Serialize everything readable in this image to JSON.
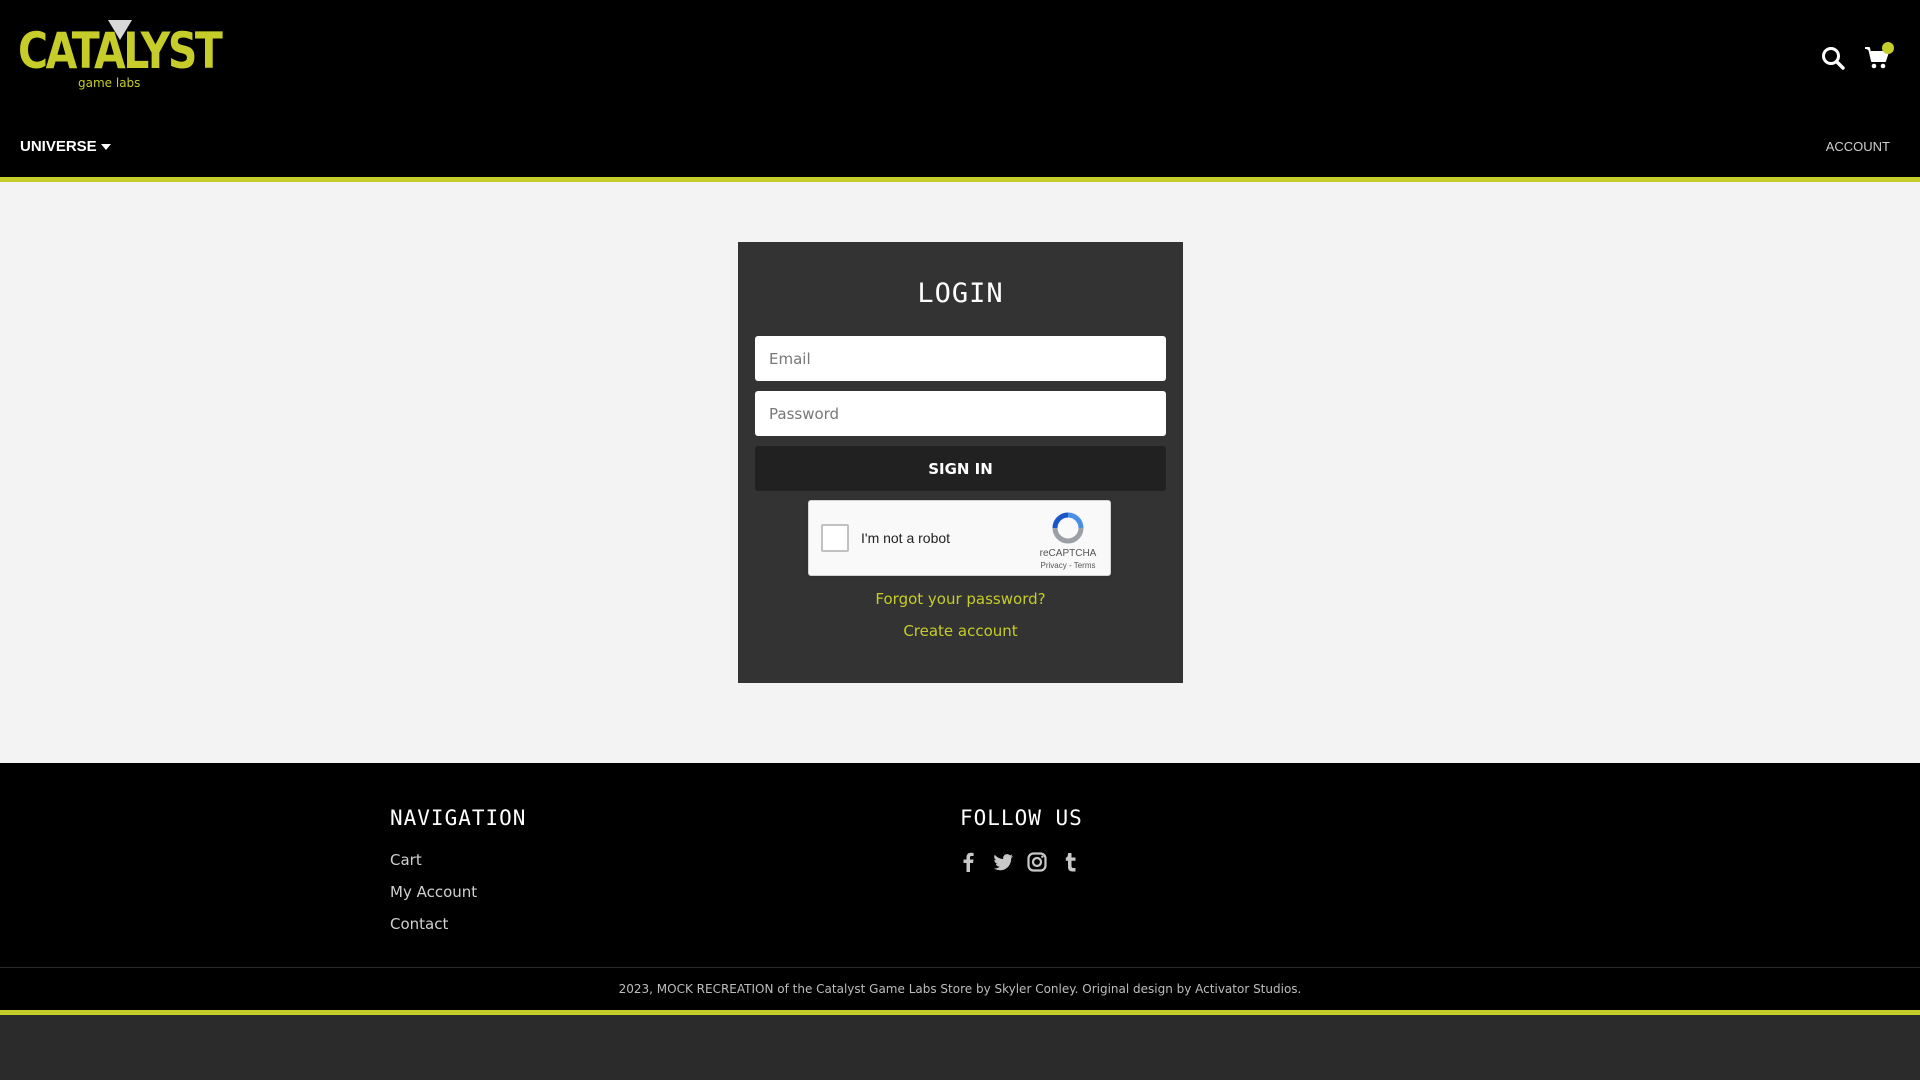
{
  "brand": {
    "logo_word": "CATALYST",
    "logo_sub": "game labs",
    "accent_color": "#c6cc29"
  },
  "header": {
    "nav_universe": "UNIVERSE",
    "nav_account": "ACCOUNT",
    "icons": [
      "search-icon",
      "cart-icon"
    ]
  },
  "login": {
    "title": "LOGIN",
    "email_placeholder": "Email",
    "password_placeholder": "Password",
    "signin_label": "SIGN IN",
    "recaptcha": {
      "label": "I'm not a robot",
      "brand": "reCAPTCHA",
      "links": "Privacy - Terms"
    },
    "forgot_link": "Forgot your password?",
    "create_link": "Create account"
  },
  "footer": {
    "nav_heading": "NAVIGATION",
    "nav_items": [
      "Cart",
      "My Account",
      "Contact"
    ],
    "follow_heading": "FOLLOW US",
    "social_icons": [
      "facebook-icon",
      "twitter-icon",
      "instagram-icon",
      "tumblr-icon"
    ],
    "copyright": "2023, MOCK RECREATION of the Catalyst Game Labs Store by Skyler Conley. Original design by Activator Studios."
  }
}
